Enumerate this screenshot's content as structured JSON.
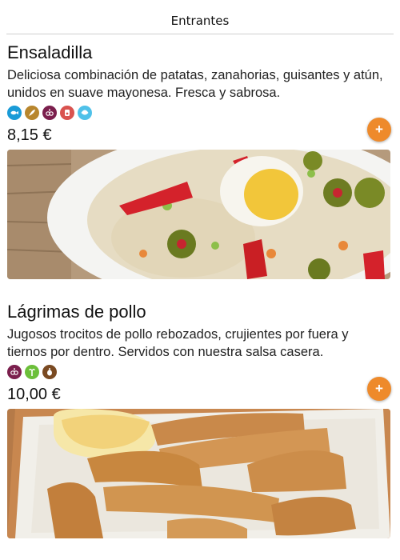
{
  "header": {
    "title": "Entrantes"
  },
  "dishes": [
    {
      "name": "Ensaladilla",
      "description": "Deliciosa combinación de patatas, zanahorias, guisantes y atún, unidos en suave mayonesa. Fresca y sabrosa.",
      "price": "8,15 €",
      "add_label": "+",
      "allergens": [
        {
          "icon": "fish-icon",
          "color": "#1a9bd7"
        },
        {
          "icon": "mustard-icon",
          "color": "#b8862d"
        },
        {
          "icon": "sulphites-icon",
          "color": "#7b1f4d"
        },
        {
          "icon": "egg-icon",
          "color": "#d9534f"
        },
        {
          "icon": "shellfish-icon",
          "color": "#4fc1e9"
        }
      ],
      "photo": "ensaladilla-photo"
    },
    {
      "name": "Lágrimas de pollo",
      "description": "Jugosos trocitos de pollo rebozados, crujientes por fuera y tiernos por dentro. Servidos con nuestra salsa casera.",
      "price": "10,00 €",
      "add_label": "+",
      "allergens": [
        {
          "icon": "sulphites-icon",
          "color": "#7b1f4d"
        },
        {
          "icon": "celery-icon",
          "color": "#6cbf3a"
        },
        {
          "icon": "gluten-icon",
          "color": "#7a4a22"
        }
      ],
      "photo": "chicken-strips-photo"
    }
  ],
  "colors": {
    "accent": "#ee8a2b",
    "divider": "#cfcfcf"
  }
}
